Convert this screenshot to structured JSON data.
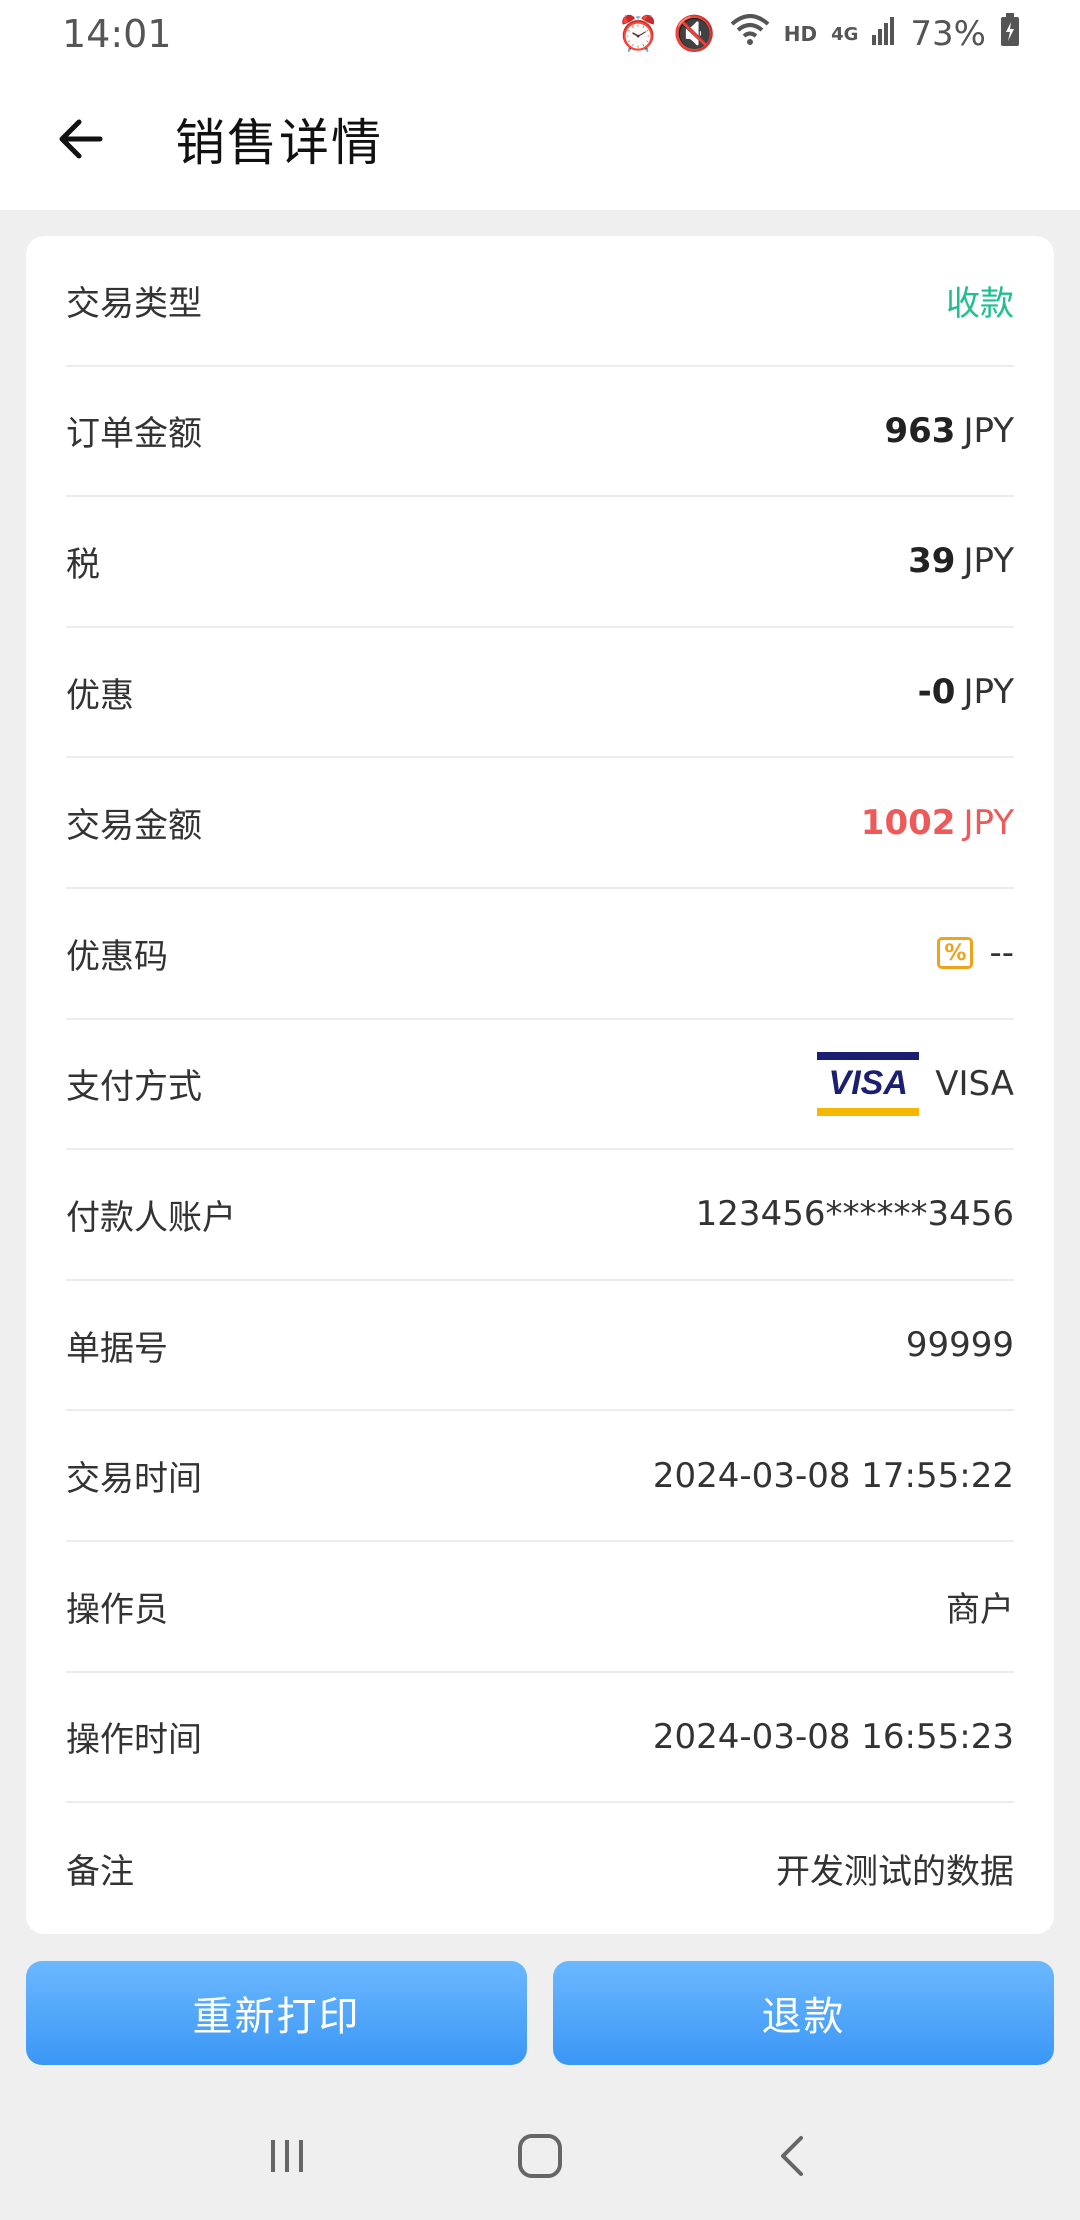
{
  "status_bar": {
    "time": "14:01",
    "network": "HD",
    "signal": "4G",
    "battery": "73%"
  },
  "header": {
    "title": "销售详情"
  },
  "details": {
    "rows": [
      {
        "label": "交易类型",
        "value": "收款"
      },
      {
        "label": "订单金额",
        "amount": "963",
        "unit": "JPY"
      },
      {
        "label": "税",
        "amount": "39",
        "unit": "JPY"
      },
      {
        "label": "优惠",
        "amount": "-0",
        "unit": "JPY"
      },
      {
        "label": "交易金额",
        "amount": "1002",
        "unit": "JPY"
      },
      {
        "label": "优惠码",
        "value": "--"
      },
      {
        "label": "支付方式",
        "value": "VISA",
        "logo_text": "VISA"
      },
      {
        "label": "付款人账户",
        "value": "123456******3456"
      },
      {
        "label": "单据号",
        "value": "99999"
      },
      {
        "label": "交易时间",
        "value": "2024-03-08 17:55:22"
      },
      {
        "label": "操作员",
        "value": "商户"
      },
      {
        "label": "操作时间",
        "value": "2024-03-08 16:55:23"
      },
      {
        "label": "备注",
        "value": "开发测试的数据"
      }
    ]
  },
  "actions": {
    "reprint_label": "重新打印",
    "refund_label": "退款"
  },
  "colors": {
    "accent_green": "#1fbf8f",
    "amount_red": "#ee5a5a",
    "button_blue": "#3a97f5",
    "coupon_orange": "#f0a21b"
  }
}
